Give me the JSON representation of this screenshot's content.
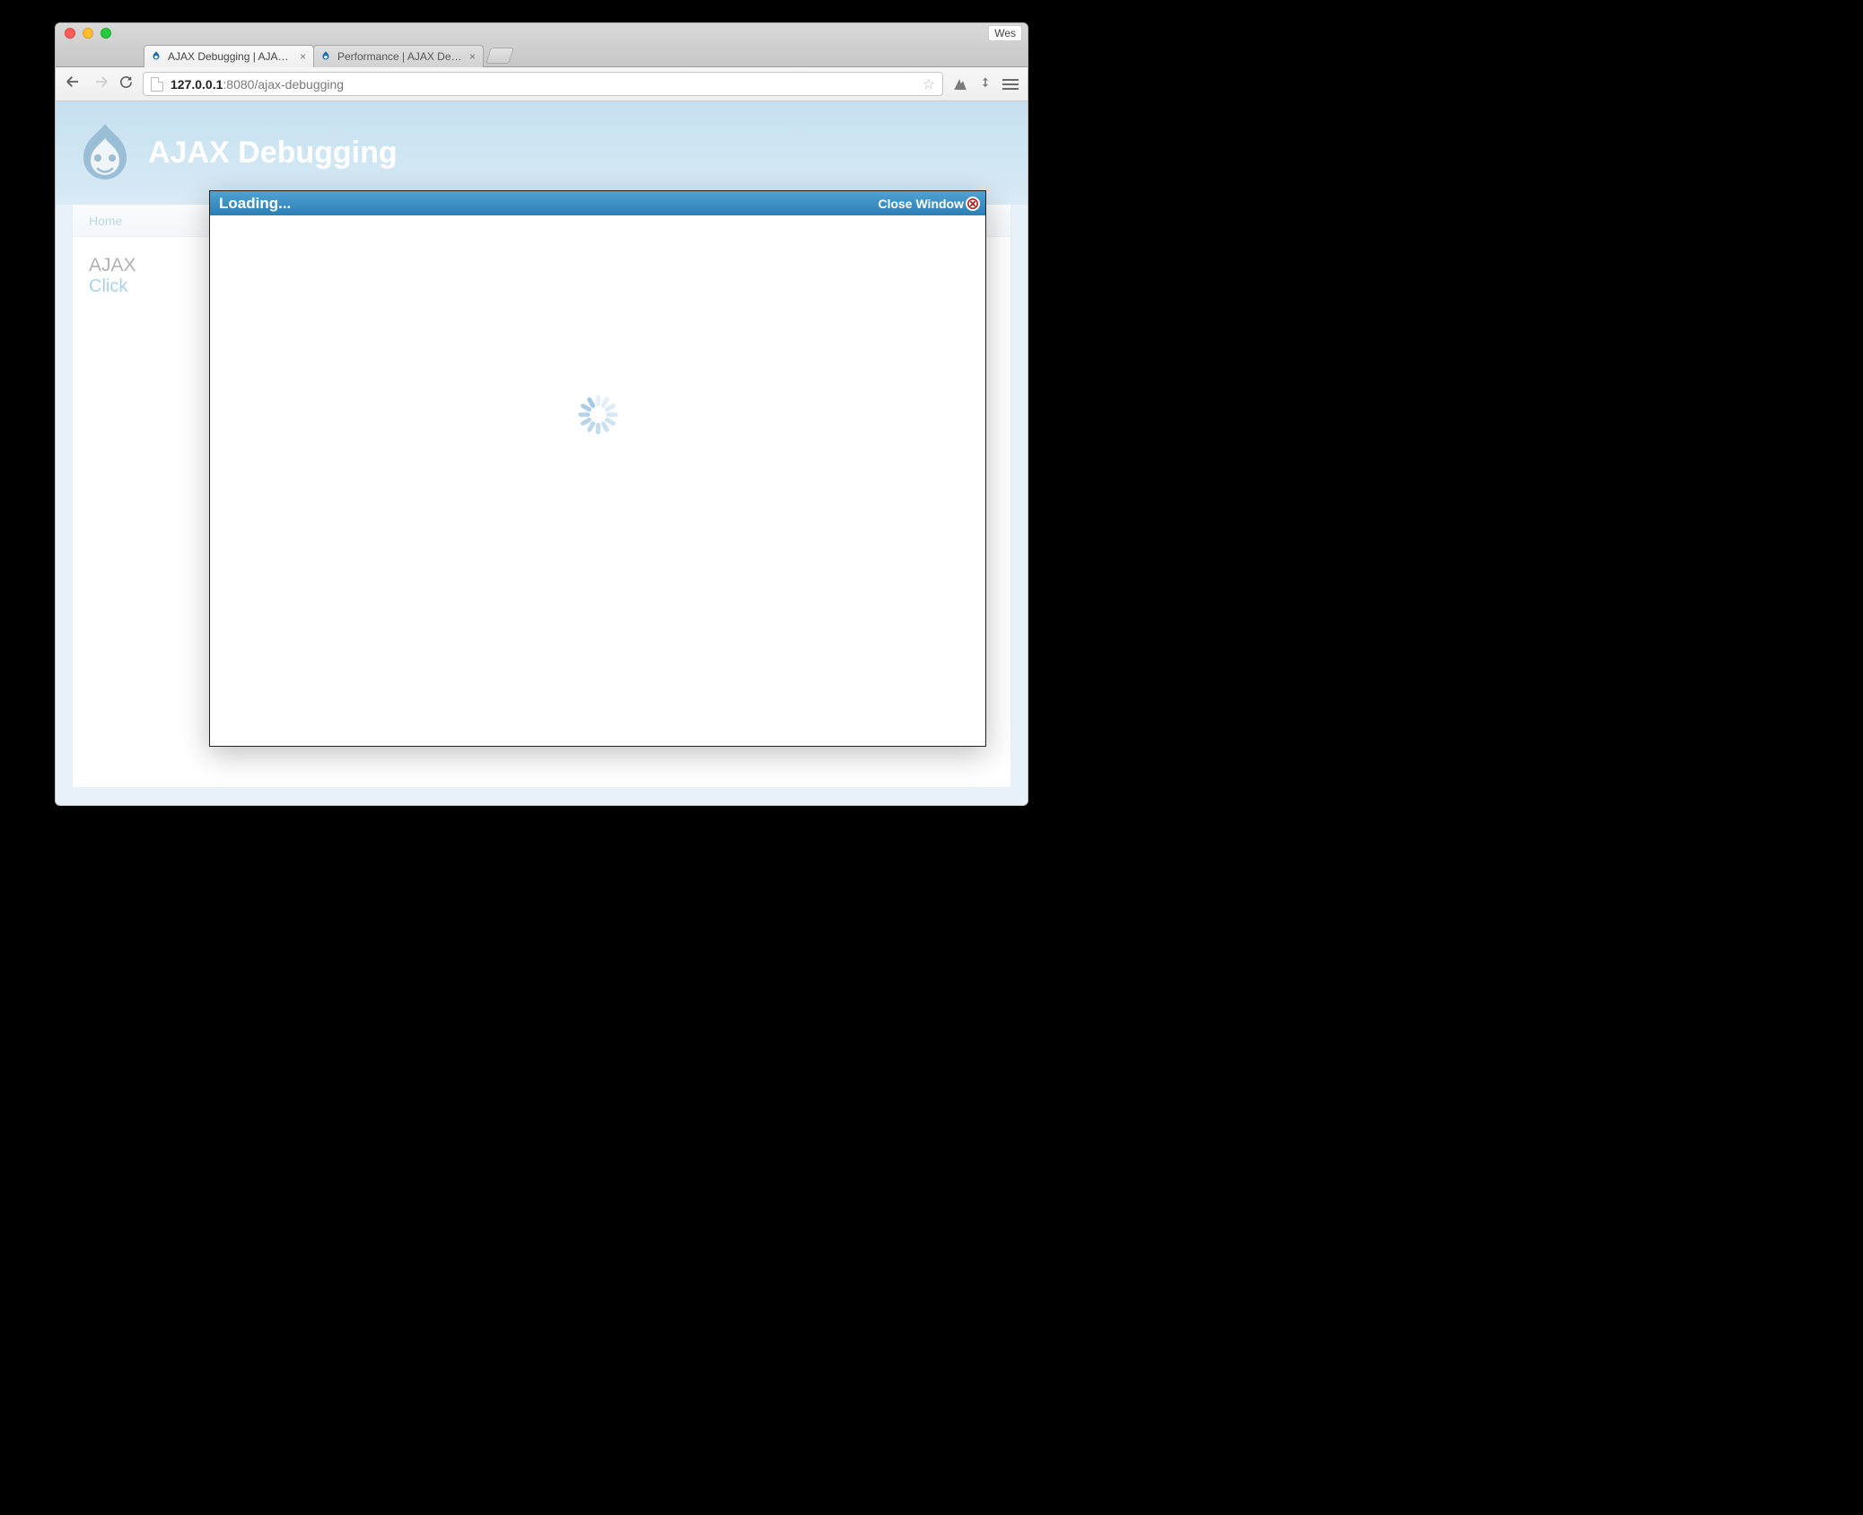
{
  "profile_label": "Wes",
  "tabs": [
    {
      "title": "AJAX Debugging | AJAX De",
      "active": true
    },
    {
      "title": "Performance | AJAX Debug",
      "active": false
    }
  ],
  "url": {
    "host": "127.0.0.1",
    "port": ":8080",
    "path": "/ajax-debugging"
  },
  "site": {
    "title": "AJAX Debugging",
    "nav_home": "Home",
    "page_heading_visible": "AJAX",
    "link_visible": "Click "
  },
  "modal": {
    "title": "Loading...",
    "close_label": "Close Window"
  }
}
